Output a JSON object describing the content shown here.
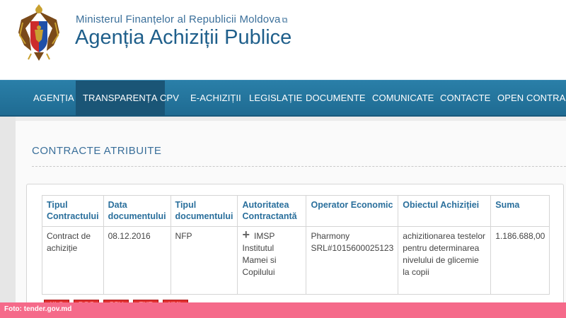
{
  "header": {
    "ministry": "Ministerul Finanțelor al Republicii Moldova",
    "ministry_ext_icon": "external-link-icon",
    "agency": "Agenția Achiziții Publice",
    "logo_icon": "moldova-coat-of-arms-icon"
  },
  "nav": {
    "items": [
      {
        "label": "AGENȚIA"
      },
      {
        "label": "TRANSPARENȚA"
      },
      {
        "label": "CPV"
      },
      {
        "label": "E-ACHIZIȚII"
      },
      {
        "label": "LEGISLAȚIE"
      },
      {
        "label": "DOCUMENTE"
      },
      {
        "label": "COMUNICATE"
      },
      {
        "label": "CONTACTE"
      },
      {
        "label": "OPEN CONTRACT"
      }
    ],
    "active": "TRANSPARENȚA"
  },
  "page": {
    "title": "CONTRACTE ATRIBUITE"
  },
  "table": {
    "headers": [
      "Tipul Contractului",
      "Data documentului",
      "Tipul documentului",
      "Autoritatea Contractantă",
      "Operator Economic",
      "Obiectul Achiziției",
      "Suma"
    ],
    "row": {
      "tipul_contractului": "Contract de achiziție",
      "data": "08.12.2016",
      "tipul_documentului": "NFP",
      "autoritatea": "IMSP Institutul Mamei si Copilului",
      "operator": "Pharmony SRL#1015600025123",
      "obiectul": "achizitionarea testelor pentru determinarea nivelului de glicemie la copii",
      "suma": "1.186.688,00",
      "expand_icon": "plus-icon"
    }
  },
  "exports": [
    "XLS",
    "DOC",
    "CSV",
    "TXT",
    "XML"
  ],
  "footer": {
    "caption": "Foto: tender.gov.md"
  }
}
